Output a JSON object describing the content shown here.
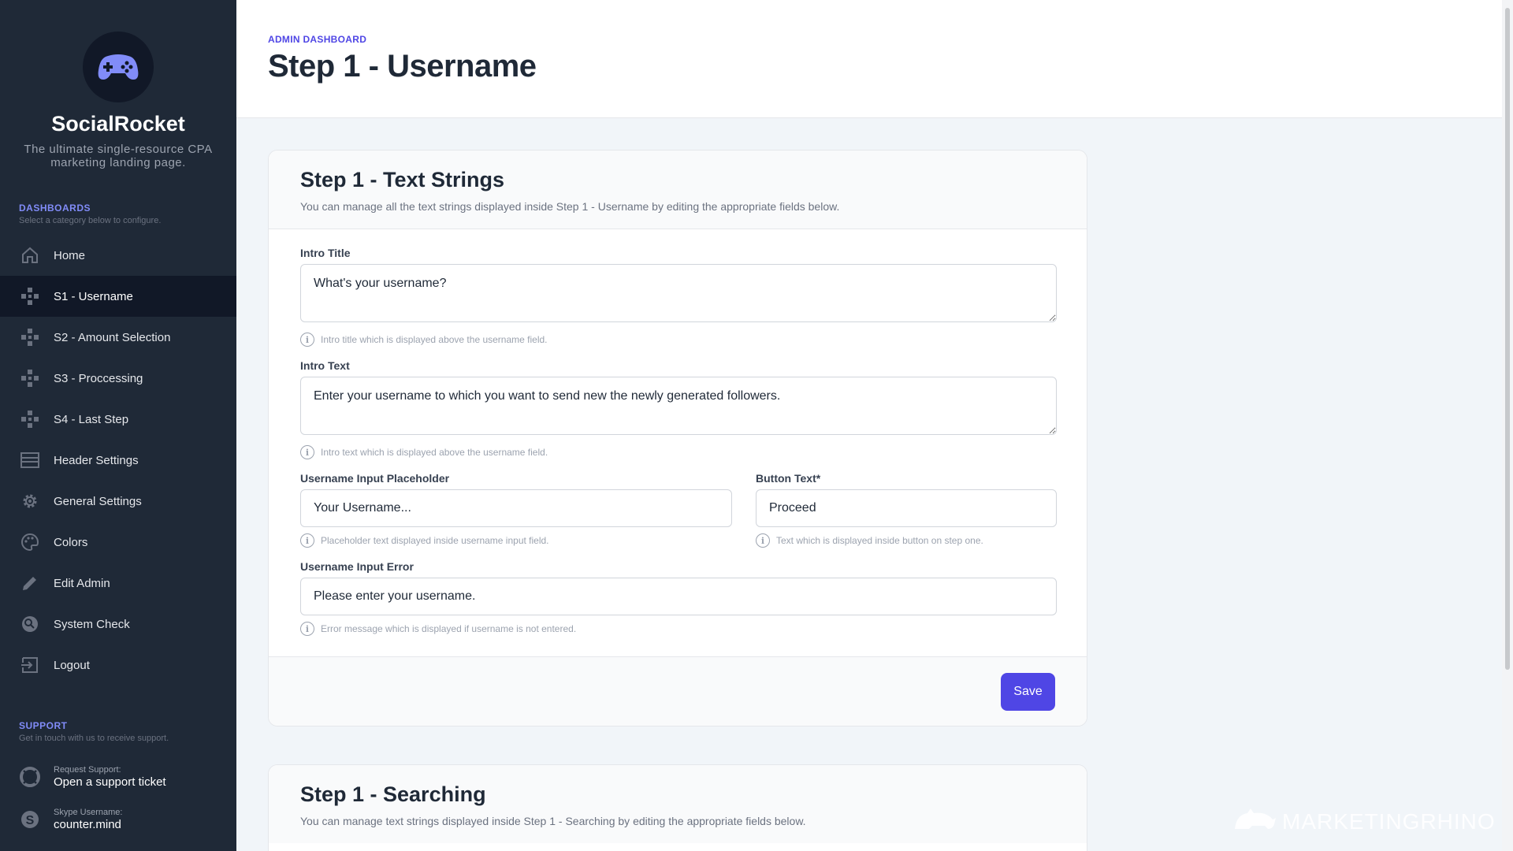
{
  "brand": {
    "name": "SocialRocket",
    "tagline": "The ultimate single-resource CPA marketing landing page."
  },
  "dashboards": {
    "title": "DASHBOARDS",
    "subtitle": "Select a category below to configure.",
    "items": [
      {
        "label": "Home",
        "icon": "home-icon"
      },
      {
        "label": "S1 - Username",
        "icon": "step-icon",
        "active": true
      },
      {
        "label": "S2 - Amount Selection",
        "icon": "step-icon"
      },
      {
        "label": "S3 - Proccessing",
        "icon": "step-icon"
      },
      {
        "label": "S4 - Last Step",
        "icon": "step-icon"
      },
      {
        "label": "Header Settings",
        "icon": "header-icon"
      },
      {
        "label": "General Settings",
        "icon": "gear-icon"
      },
      {
        "label": "Colors",
        "icon": "palette-icon"
      },
      {
        "label": "Edit Admin",
        "icon": "pencil-icon"
      },
      {
        "label": "System Check",
        "icon": "check-icon"
      },
      {
        "label": "Logout",
        "icon": "logout-icon"
      }
    ]
  },
  "support": {
    "title": "SUPPORT",
    "subtitle": "Get in touch with us to receive support.",
    "ticket_small": "Request Support:",
    "ticket_main": "Open a support ticket",
    "skype_small": "Skype Username:",
    "skype_main": "counter.mind"
  },
  "header": {
    "breadcrumb": "ADMIN DASHBOARD",
    "title": "Step 1 - Username"
  },
  "card1": {
    "title": "Step 1 - Text Strings",
    "description": "You can manage all the text strings displayed inside Step 1 - Username by editing the appropriate fields below.",
    "intro_title": {
      "label": "Intro Title",
      "value": "What's your username?",
      "help": "Intro title which is displayed above the username field."
    },
    "intro_text": {
      "label": "Intro Text",
      "value": "Enter your username to which you want to send new the newly generated followers.",
      "help": "Intro text which is displayed above the username field."
    },
    "placeholder": {
      "label": "Username Input Placeholder",
      "value": "Your Username...",
      "help": "Placeholder text displayed inside username input field."
    },
    "button_text": {
      "label": "Button Text*",
      "value": "Proceed",
      "help": "Text which is displayed inside button on step one."
    },
    "input_error": {
      "label": "Username Input Error",
      "value": "Please enter your username.",
      "help": "Error message which is displayed if username is not entered."
    },
    "save_label": "Save"
  },
  "card2": {
    "title": "Step 1 - Searching",
    "description": "You can manage text strings displayed inside Step 1 - Searching by editing the appropriate fields below."
  },
  "watermark": "MARKETINGRHINO",
  "colors": {
    "sidebar": "#1f2937",
    "accent": "#4f46e5",
    "brand_icon": "#818cf8"
  }
}
